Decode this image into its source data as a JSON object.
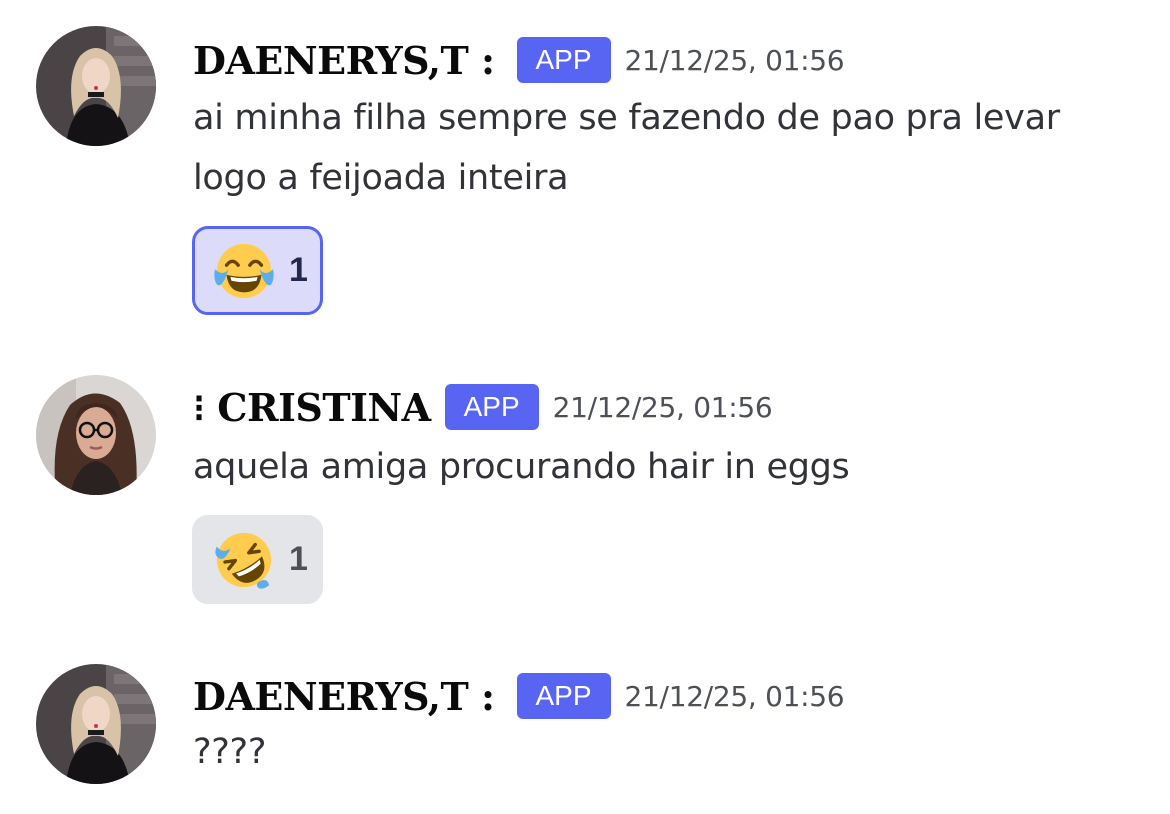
{
  "messages": [
    {
      "author": "DAENERYS,T :",
      "badge": "APP",
      "timestamp": "21/12/25, 01:56",
      "lines": [
        "ai minha filha sempre se fazendo de pao pra levar",
        "logo a feijoada inteira"
      ],
      "reaction": {
        "emoji": "joy-face-icon",
        "count": "1",
        "selected": true
      }
    },
    {
      "author": "⁝ CRISTINA",
      "badge": "APP",
      "timestamp": "21/12/25, 01:56",
      "lines": [
        "aquela amiga procurando hair in eggs"
      ],
      "reaction": {
        "emoji": "rofl-face-icon",
        "count": "1",
        "selected": false
      }
    },
    {
      "author": "DAENERYS,T :",
      "badge": "APP",
      "timestamp": "21/12/25, 01:56",
      "lines": [
        "????"
      ]
    }
  ],
  "colors": {
    "badge": "#5865f2",
    "reaction_selected_bg": "#dcdcfa",
    "reaction_selected_border": "#5865f2",
    "reaction_bg": "#e3e5e8"
  }
}
